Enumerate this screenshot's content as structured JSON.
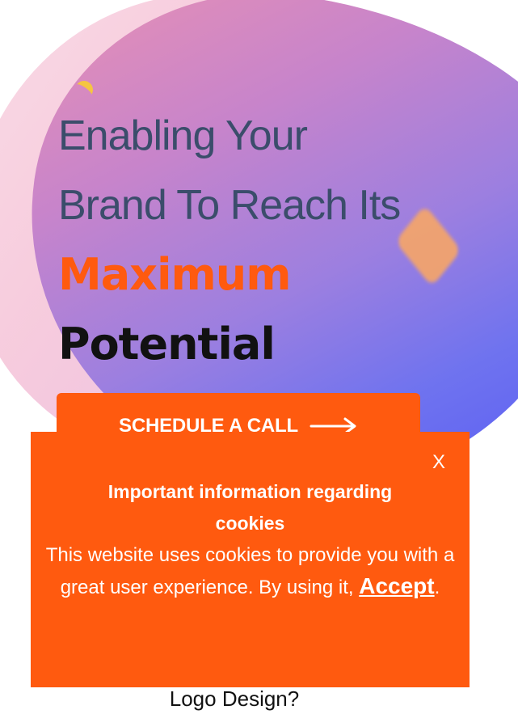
{
  "hero": {
    "headline_line1": "Enabling Your",
    "headline_line2": "Brand To Reach Its",
    "headline_accent": "Maximum",
    "headline_strong": "Potential"
  },
  "cta": {
    "label": "SCHEDULE A CALL",
    "icon": "arrow-right-icon"
  },
  "behind_text": "Logo Design?",
  "cookie_banner": {
    "close_label": "X",
    "title": "Important information regarding cookies",
    "body_text": "This website uses cookies to provide you with a great user experience. By using it, ",
    "accept_label": "Accept",
    "trailing_punct": "."
  },
  "colors": {
    "accent": "#ff5a0f",
    "headline": "#3b4d6b",
    "dark_text": "#111111"
  }
}
